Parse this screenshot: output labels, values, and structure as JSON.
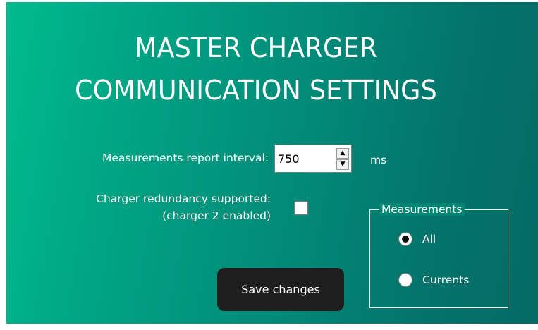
{
  "title": {
    "line1": "MASTER CHARGER",
    "line2": "COMMUNICATION SETTINGS"
  },
  "interval": {
    "label": "Measurements report interval:",
    "value": "750",
    "unit": "ms",
    "up_icon": "spin-up-arrow",
    "down_icon": "spin-down-arrow"
  },
  "redundancy": {
    "label_line1": "Charger redundancy supported:",
    "label_line2": "(charger 2 enabled)",
    "checked": false
  },
  "save_button": {
    "label": "Save changes"
  },
  "measurements": {
    "group_title": "Measurements",
    "options": [
      {
        "label": "All",
        "selected": true
      },
      {
        "label": "Currents",
        "selected": false
      }
    ]
  },
  "colors": {
    "gradient_start": "#00bb8c",
    "gradient_end": "#046a64",
    "button_bg": "#1e1e1e",
    "text": "#ffffff"
  }
}
